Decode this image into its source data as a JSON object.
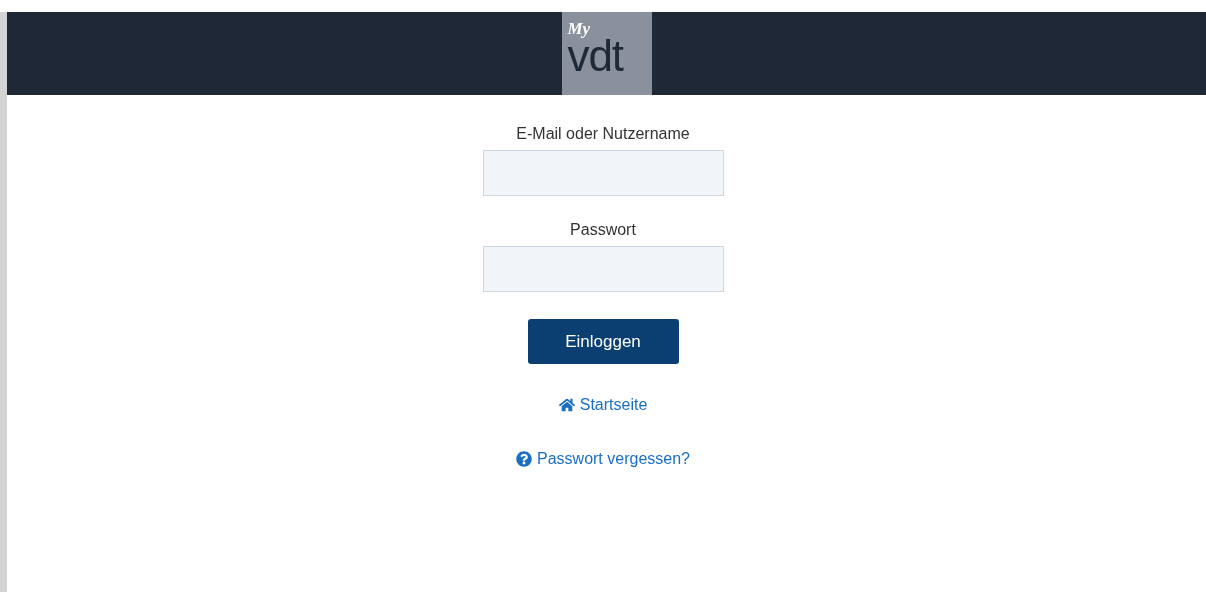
{
  "header": {
    "logo": {
      "prefix": "My",
      "name": "vdt"
    }
  },
  "fields": [
    {
      "label": "E-Mail oder Nutzername"
    },
    {
      "label": "Passwort"
    }
  ],
  "submit": {
    "label": "Einloggen"
  },
  "links": [
    {
      "label": "Startseite",
      "kind": "home"
    },
    {
      "label": "Passwort vergessen?",
      "kind": "help"
    }
  ]
}
